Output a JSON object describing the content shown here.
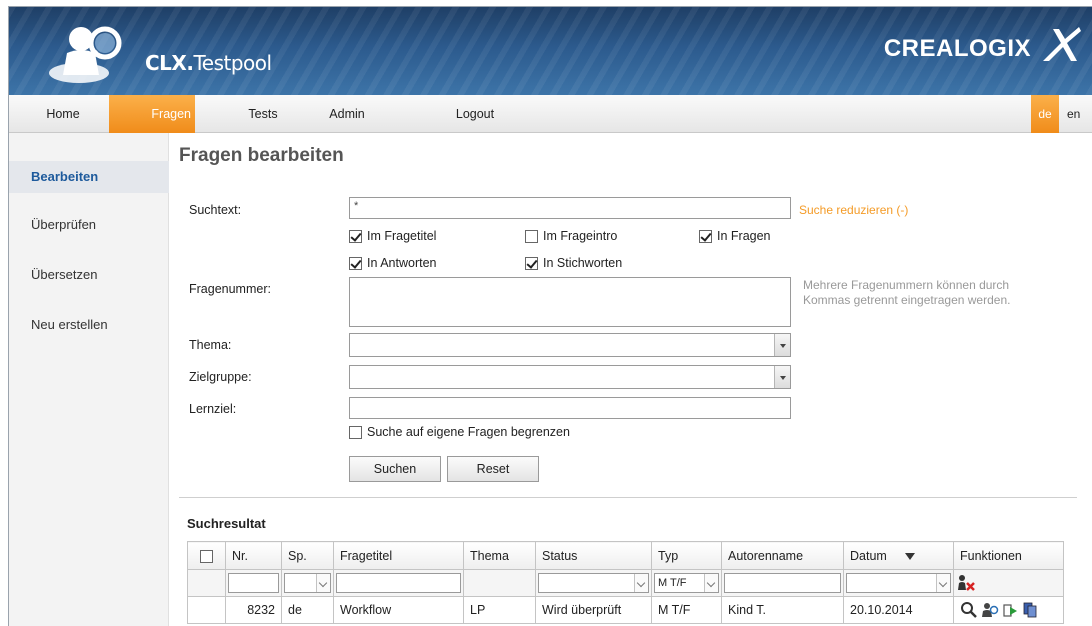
{
  "app": {
    "title_bold": "CLX.",
    "title_rest": "Testpool",
    "brand": "CREALOGIX"
  },
  "nav": {
    "items": [
      "Home",
      "Fragen",
      "Tests",
      "Admin",
      "Logout"
    ],
    "active": "Fragen",
    "lang_de": "de",
    "lang_en": "en"
  },
  "sidebar": {
    "items": [
      "Bearbeiten",
      "Überprüfen",
      "Übersetzen",
      "Neu erstellen"
    ],
    "active": "Bearbeiten"
  },
  "form": {
    "page_title": "Fragen bearbeiten",
    "suchtext_label": "Suchtext:",
    "suchtext_value": "*",
    "reduce_link": "Suche reduzieren (-)",
    "checkboxes": {
      "im_fragetitel": {
        "label": "Im Fragetitel",
        "checked": true
      },
      "im_frageintro": {
        "label": "Im Frageintro",
        "checked": false
      },
      "in_fragen": {
        "label": "In Fragen",
        "checked": true
      },
      "in_antworten": {
        "label": "In Antworten",
        "checked": true
      },
      "in_stichworten": {
        "label": "In Stichworten",
        "checked": true
      }
    },
    "fragenummer_label": "Fragenummer:",
    "fragenummer_hint_1": "Mehrere Fragenummern können durch",
    "fragenummer_hint_2": "Kommas getrennt eingetragen werden.",
    "thema_label": "Thema:",
    "zielgruppe_label": "Zielgruppe:",
    "lernziel_label": "Lernziel:",
    "eigene_label": "Suche auf eigene Fragen begrenzen",
    "search_button": "Suchen",
    "reset_button": "Reset"
  },
  "results": {
    "title": "Suchresultat",
    "columns": [
      "Nr.",
      "Sp.",
      "Fragetitel",
      "Thema",
      "Status",
      "Typ",
      "Autorenname",
      "Datum",
      "Funktionen"
    ],
    "filter_typ": "M T/F",
    "rows": [
      {
        "nr": "8232",
        "sp": "de",
        "fragetitel": "Workflow",
        "thema": "LP",
        "status": "Wird überprüft",
        "typ": "M T/F",
        "autor": "Kind T.",
        "datum": "20.10.2014"
      }
    ]
  },
  "colors": {
    "accent_orange": "#f08c1a",
    "nav_blue": "#1d5a9c",
    "header_blue": "#2c5a8d"
  },
  "icons": [
    "magnifier-person-icon",
    "crealogix-x-icon",
    "clear-filter-icon",
    "search-icon",
    "review-icon",
    "export-icon",
    "copy-icon",
    "sort-desc-icon"
  ]
}
